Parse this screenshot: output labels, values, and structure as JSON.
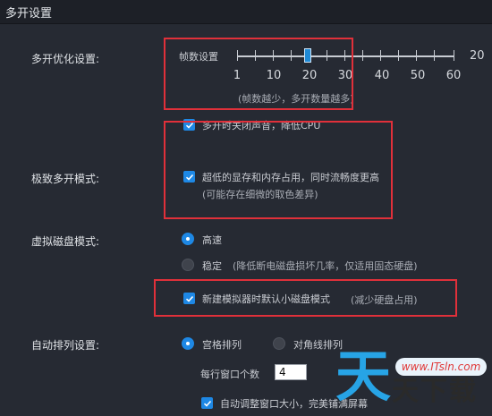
{
  "window": {
    "title": "多开设置"
  },
  "sections": {
    "optimize": {
      "label": "多开优化设置:",
      "fps_label": "帧数设置",
      "ticks": [
        "1",
        "10",
        "20",
        "30",
        "40",
        "50",
        "60"
      ],
      "current_value": "20",
      "hint": "(帧数越少，多开数量越多)",
      "mute_checkbox_label": "多开时关闭声音，降低CPU",
      "mute_checked": true
    },
    "extreme": {
      "label": "极致多开模式:",
      "checkbox_label": "超低的显存和内存占用，同时流畅度更高",
      "checked": true,
      "note": "(可能存在细微的取色差异)"
    },
    "vdisk": {
      "label": "虚拟磁盘模式:",
      "option_fast": "高速",
      "option_stable": "稳定",
      "option_stable_note": "(降低断电磁盘损坏几率，仅适用固态硬盘)",
      "selected": "高速",
      "small_disk_label": "新建模拟器时默认小磁盘模式",
      "small_disk_note": "(减少硬盘占用)",
      "small_disk_checked": true
    },
    "arrange": {
      "label": "自动排列设置:",
      "option_grid": "宫格排列",
      "option_diagonal": "对角线排列",
      "selected": "宫格排列",
      "per_row_label": "每行窗口个数",
      "per_row_value": "4",
      "auto_adjust_label": "自动调整窗口大小，完美铺满屏幕",
      "auto_adjust_checked": true
    }
  },
  "watermark": {
    "big_char": "天",
    "small_text": "天下载",
    "url": "www.ITsln.com"
  },
  "colors": {
    "background": "#262a33",
    "accent": "#1e88e5",
    "annotation": "#e0303a",
    "watermark_blue": "#27a4e6"
  }
}
